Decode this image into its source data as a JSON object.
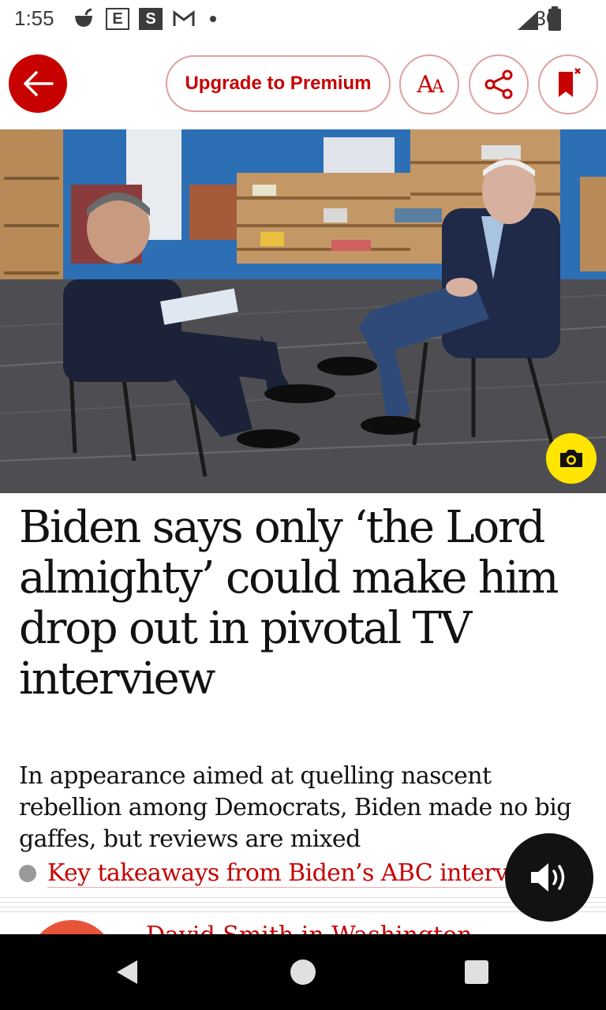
{
  "status_bar": {
    "time": "1:55",
    "icons_left": [
      "notification-cup-icon",
      "e-icon",
      "s-icon",
      "gmail-icon",
      "dot-icon"
    ],
    "e_letter": "E",
    "s_letter": "S",
    "network": "3G",
    "icons_right": [
      "signal-icon",
      "battery-icon"
    ]
  },
  "toolbar": {
    "premium_label": "Upgrade to Premium",
    "font_label": "AA",
    "back_icon": "arrow-left-icon",
    "share_icon": "share-icon",
    "bookmark_icon": "bookmark-remove-icon"
  },
  "hero": {
    "icon": "camera-icon"
  },
  "article": {
    "headline": "Biden says only ‘the Lord almighty’ could make him drop out in pivotal TV interview",
    "standfirst": "In appearance aimed at quelling nascent rebellion among Democrats, Biden made no big gaffes, but reviews are mixed",
    "key_link": "Key takeaways from Biden’s ABC interview",
    "byline_peek": "David Smith in Washington"
  },
  "audio": {
    "icon": "speaker-icon"
  },
  "colors": {
    "brand_red": "#c70000",
    "camera_yellow": "#ffe500",
    "text": "#121212"
  }
}
